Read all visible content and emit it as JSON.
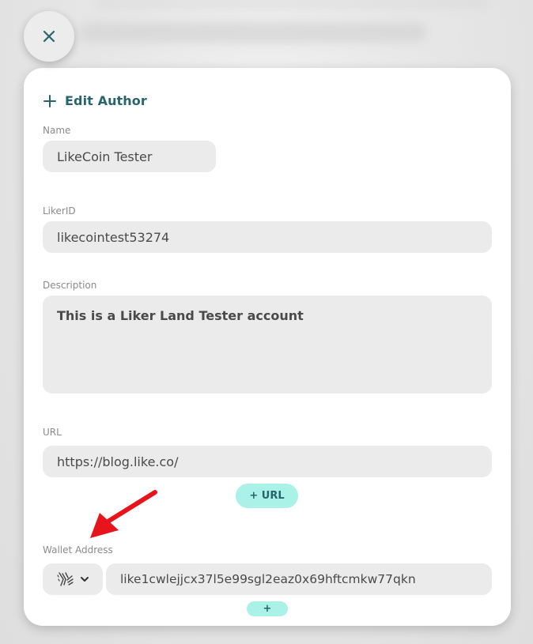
{
  "form": {
    "title": "Edit Author",
    "name": {
      "label": "Name",
      "value": "LikeCoin Tester"
    },
    "liker_id": {
      "label": "LikerID",
      "value": "likecointest53274"
    },
    "description": {
      "label": "Description",
      "value": "This is a Liker Land Tester account"
    },
    "url": {
      "label": "URL",
      "value": "https://blog.like.co/",
      "add_label": "+ URL"
    },
    "wallet": {
      "label": "Wallet Address",
      "chain_icon": "cosmos-hands-icon",
      "value": "like1cwlejjcx37l5e99sgl2eaz0x69hftcmkw77qkn",
      "add_label": "+"
    }
  },
  "icons": {
    "close": "close-icon",
    "title_plus": "plus-icon",
    "dropdown": "chevron-down-icon",
    "annotation": "red-arrow-icon"
  },
  "colors": {
    "accent": "#28646e",
    "pill_bg": "#aaf1e7",
    "field_bg": "#ebebeb",
    "annotation": "#e8141c"
  }
}
